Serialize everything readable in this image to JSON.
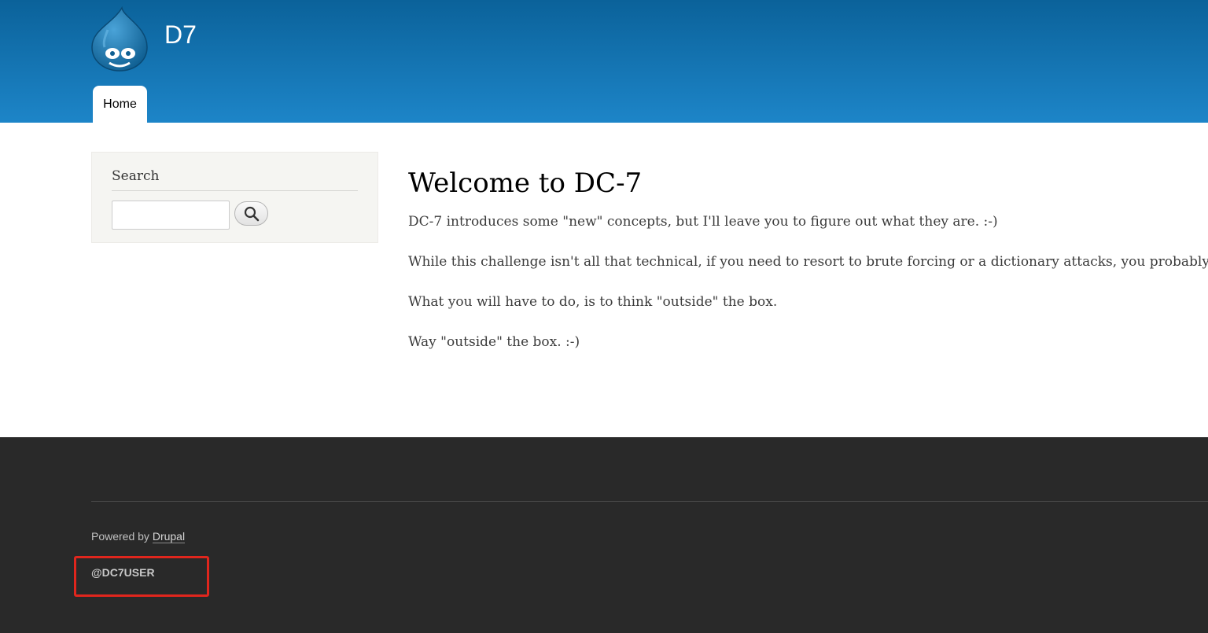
{
  "header": {
    "site_name": "D7",
    "logo": "drupal-drop-logo",
    "nav": [
      {
        "label": "Home",
        "active": true
      }
    ],
    "colors": {
      "top": "#0b629a",
      "bottom": "#1d85c8"
    }
  },
  "sidebar": {
    "search": {
      "title": "Search",
      "input_value": "",
      "button_icon": "search-icon"
    }
  },
  "main": {
    "title": "Welcome to DC-7",
    "paragraphs": [
      "DC-7 introduces some \"new\" concepts, but I'll leave you to figure out what they are.  :-)",
      "While this challenge isn't all that technical, if you need to resort to brute forcing or a dictionary attacks, you probably won't",
      "What you will have to do, is to think \"outside\" the box.",
      "Way \"outside\" the box.  :-)"
    ]
  },
  "footer": {
    "powered_prefix": "Powered by ",
    "powered_link": "Drupal",
    "user_tag": "@DC7USER",
    "highlight_color": "#e0261d",
    "background": "#292929"
  }
}
